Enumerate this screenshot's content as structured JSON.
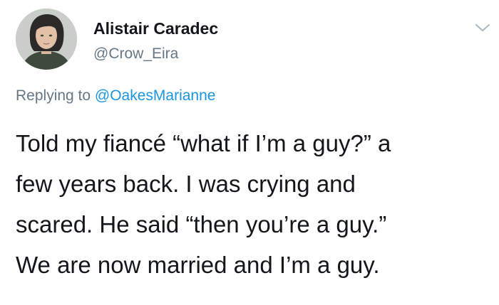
{
  "user": {
    "display_name": "Alistair Caradec",
    "handle": "@Crow_Eira"
  },
  "reply": {
    "prefix": "Replying to ",
    "mention": "@OakesMarianne"
  },
  "tweet": {
    "lines": [
      "Told my fiancé “what if I’m a guy?” a",
      "few years back. I was crying and",
      "scared. He said “then you’re a guy.”",
      "We are now married and I’m a guy."
    ]
  },
  "icons": {
    "menu": "chevron-down-icon",
    "avatar": "avatar"
  },
  "colors": {
    "text": "#14171a",
    "secondary": "#657786",
    "link": "#1b95e0",
    "background": "#ffffff"
  }
}
